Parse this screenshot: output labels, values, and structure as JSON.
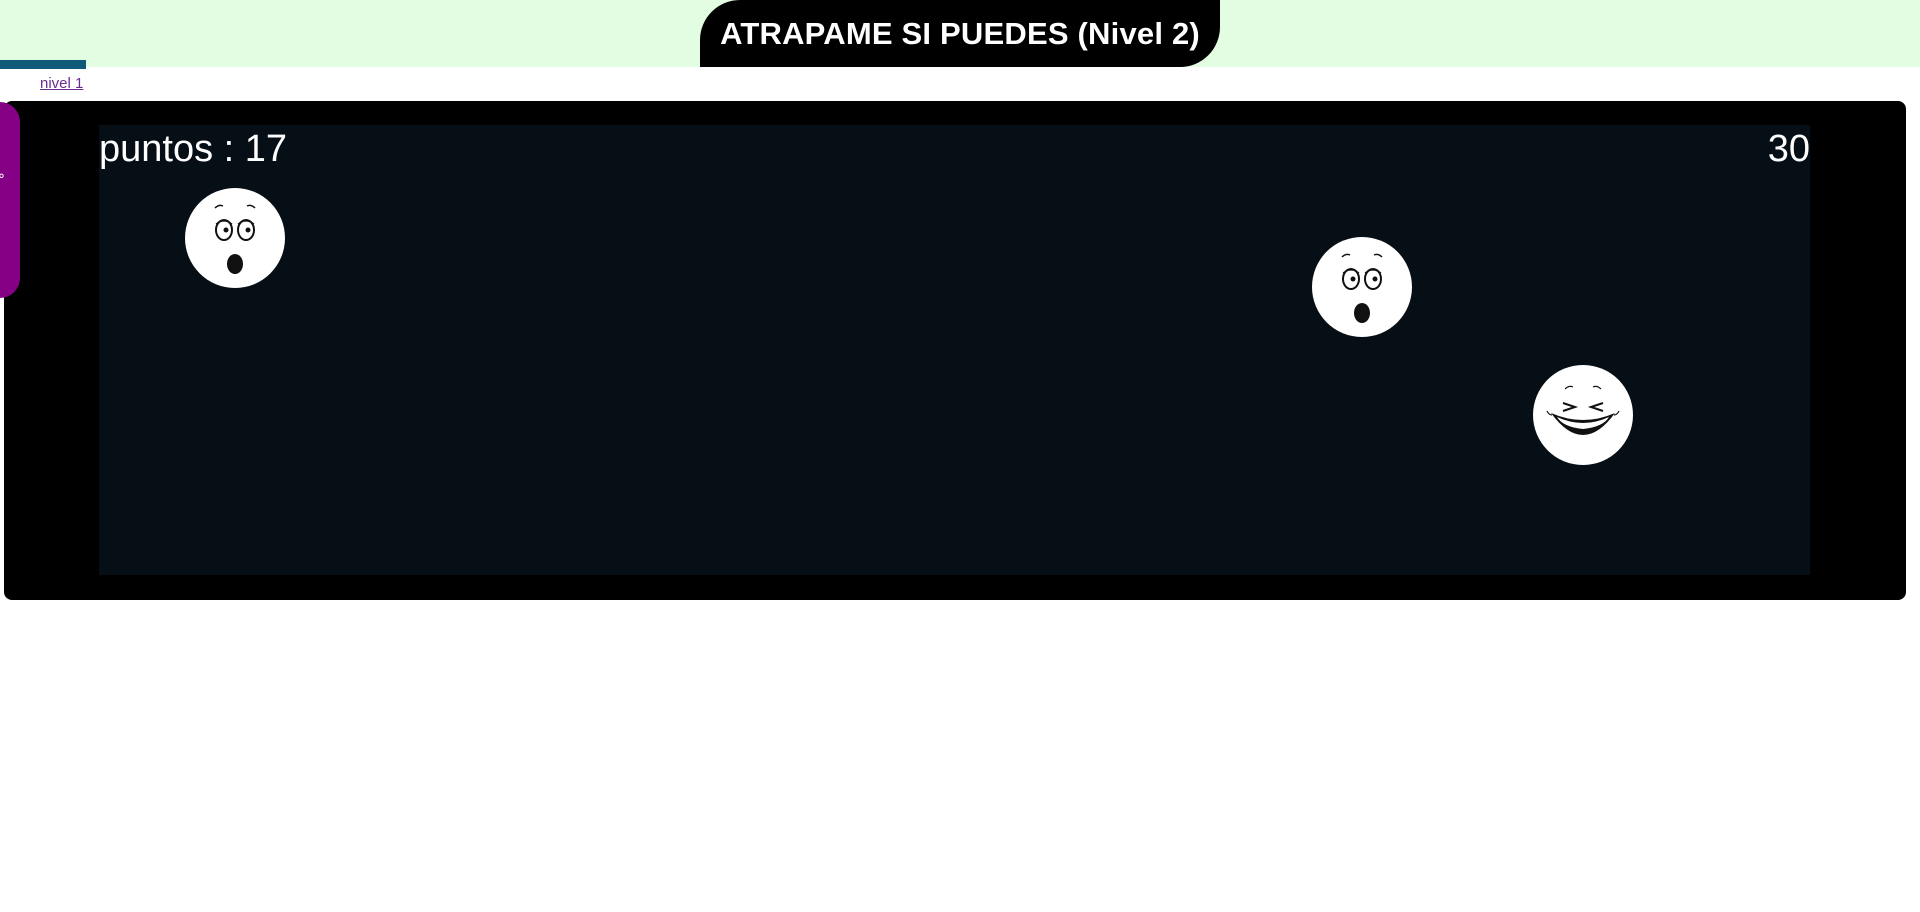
{
  "header": {
    "title": "ATRAPAME SI PUEDES (Nivel 2)",
    "link_label": "nivel 1",
    "bg_color": "#e2fde2"
  },
  "side_tab": {
    "color": "#860086",
    "glyph": "°"
  },
  "game": {
    "score_text": "puntos : 17",
    "timer_text": "30",
    "targets": [
      {
        "name": "surprised-face",
        "icon": "surprised-face-icon"
      },
      {
        "name": "surprised-face",
        "icon": "surprised-face-icon"
      },
      {
        "name": "laughing-face",
        "icon": "laughing-face-icon"
      }
    ]
  }
}
